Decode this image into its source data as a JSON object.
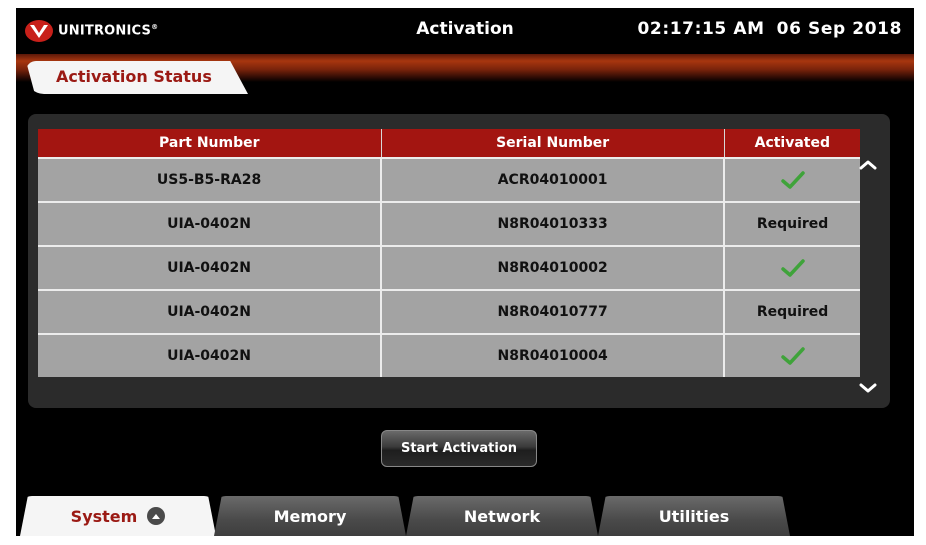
{
  "header": {
    "brand": "UNITRONICS",
    "brand_mark": "®",
    "title": "Activation",
    "time": "02:17:15 AM",
    "date": "06 Sep 2018"
  },
  "status_tab": {
    "label": "Activation Status"
  },
  "table": {
    "columns": [
      "Part Number",
      "Serial Number",
      "Activated"
    ],
    "rows": [
      {
        "part": "US5-B5-RA28",
        "serial": "ACR04010001",
        "activated": "check-icon"
      },
      {
        "part": "UIA-0402N",
        "serial": "N8R04010333",
        "activated": "Required"
      },
      {
        "part": "UIA-0402N",
        "serial": "N8R04010002",
        "activated": "check-icon"
      },
      {
        "part": "UIA-0402N",
        "serial": "N8R04010777",
        "activated": "Required"
      },
      {
        "part": "UIA-0402N",
        "serial": "N8R04010004",
        "activated": "check-icon"
      }
    ]
  },
  "start_button": {
    "label": "Start Activation"
  },
  "tabs": [
    {
      "label": "System",
      "active": true
    },
    {
      "label": "Memory",
      "active": false
    },
    {
      "label": "Network",
      "active": false
    },
    {
      "label": "Utilities",
      "active": false
    }
  ],
  "colors": {
    "accent_red": "#a31511",
    "check_green": "#3fa33a",
    "row_gray": "#a3a3a3"
  }
}
